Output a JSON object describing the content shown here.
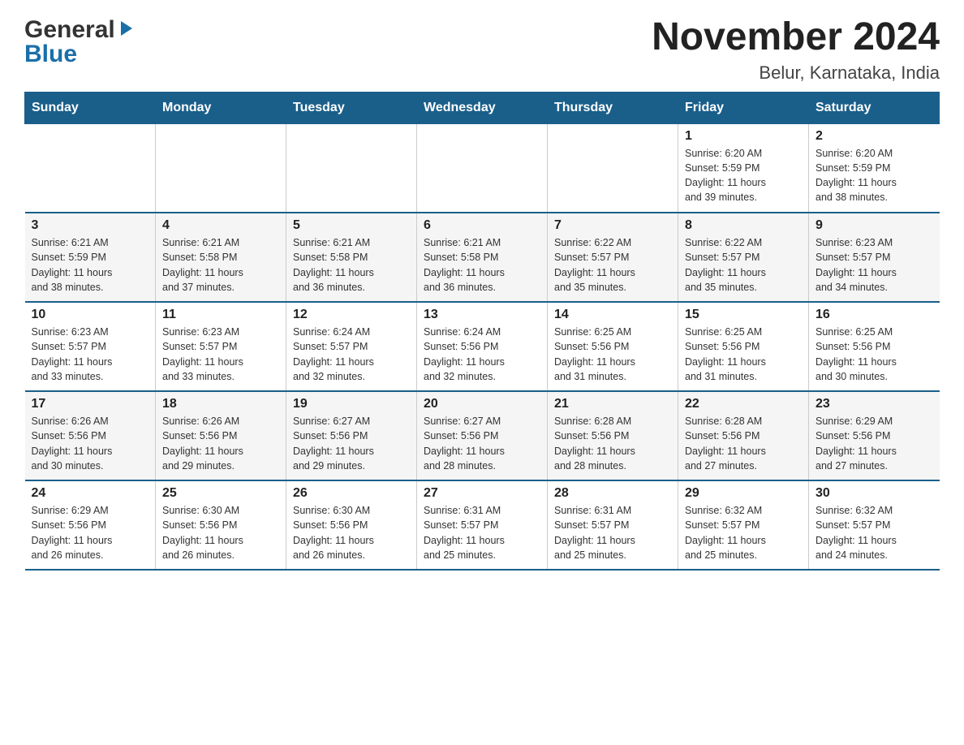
{
  "header": {
    "logo_general": "General",
    "logo_blue": "Blue",
    "month_title": "November 2024",
    "location": "Belur, Karnataka, India"
  },
  "days_of_week": [
    "Sunday",
    "Monday",
    "Tuesday",
    "Wednesday",
    "Thursday",
    "Friday",
    "Saturday"
  ],
  "weeks": [
    [
      {
        "day": "",
        "info": ""
      },
      {
        "day": "",
        "info": ""
      },
      {
        "day": "",
        "info": ""
      },
      {
        "day": "",
        "info": ""
      },
      {
        "day": "",
        "info": ""
      },
      {
        "day": "1",
        "info": "Sunrise: 6:20 AM\nSunset: 5:59 PM\nDaylight: 11 hours\nand 39 minutes."
      },
      {
        "day": "2",
        "info": "Sunrise: 6:20 AM\nSunset: 5:59 PM\nDaylight: 11 hours\nand 38 minutes."
      }
    ],
    [
      {
        "day": "3",
        "info": "Sunrise: 6:21 AM\nSunset: 5:59 PM\nDaylight: 11 hours\nand 38 minutes."
      },
      {
        "day": "4",
        "info": "Sunrise: 6:21 AM\nSunset: 5:58 PM\nDaylight: 11 hours\nand 37 minutes."
      },
      {
        "day": "5",
        "info": "Sunrise: 6:21 AM\nSunset: 5:58 PM\nDaylight: 11 hours\nand 36 minutes."
      },
      {
        "day": "6",
        "info": "Sunrise: 6:21 AM\nSunset: 5:58 PM\nDaylight: 11 hours\nand 36 minutes."
      },
      {
        "day": "7",
        "info": "Sunrise: 6:22 AM\nSunset: 5:57 PM\nDaylight: 11 hours\nand 35 minutes."
      },
      {
        "day": "8",
        "info": "Sunrise: 6:22 AM\nSunset: 5:57 PM\nDaylight: 11 hours\nand 35 minutes."
      },
      {
        "day": "9",
        "info": "Sunrise: 6:23 AM\nSunset: 5:57 PM\nDaylight: 11 hours\nand 34 minutes."
      }
    ],
    [
      {
        "day": "10",
        "info": "Sunrise: 6:23 AM\nSunset: 5:57 PM\nDaylight: 11 hours\nand 33 minutes."
      },
      {
        "day": "11",
        "info": "Sunrise: 6:23 AM\nSunset: 5:57 PM\nDaylight: 11 hours\nand 33 minutes."
      },
      {
        "day": "12",
        "info": "Sunrise: 6:24 AM\nSunset: 5:57 PM\nDaylight: 11 hours\nand 32 minutes."
      },
      {
        "day": "13",
        "info": "Sunrise: 6:24 AM\nSunset: 5:56 PM\nDaylight: 11 hours\nand 32 minutes."
      },
      {
        "day": "14",
        "info": "Sunrise: 6:25 AM\nSunset: 5:56 PM\nDaylight: 11 hours\nand 31 minutes."
      },
      {
        "day": "15",
        "info": "Sunrise: 6:25 AM\nSunset: 5:56 PM\nDaylight: 11 hours\nand 31 minutes."
      },
      {
        "day": "16",
        "info": "Sunrise: 6:25 AM\nSunset: 5:56 PM\nDaylight: 11 hours\nand 30 minutes."
      }
    ],
    [
      {
        "day": "17",
        "info": "Sunrise: 6:26 AM\nSunset: 5:56 PM\nDaylight: 11 hours\nand 30 minutes."
      },
      {
        "day": "18",
        "info": "Sunrise: 6:26 AM\nSunset: 5:56 PM\nDaylight: 11 hours\nand 29 minutes."
      },
      {
        "day": "19",
        "info": "Sunrise: 6:27 AM\nSunset: 5:56 PM\nDaylight: 11 hours\nand 29 minutes."
      },
      {
        "day": "20",
        "info": "Sunrise: 6:27 AM\nSunset: 5:56 PM\nDaylight: 11 hours\nand 28 minutes."
      },
      {
        "day": "21",
        "info": "Sunrise: 6:28 AM\nSunset: 5:56 PM\nDaylight: 11 hours\nand 28 minutes."
      },
      {
        "day": "22",
        "info": "Sunrise: 6:28 AM\nSunset: 5:56 PM\nDaylight: 11 hours\nand 27 minutes."
      },
      {
        "day": "23",
        "info": "Sunrise: 6:29 AM\nSunset: 5:56 PM\nDaylight: 11 hours\nand 27 minutes."
      }
    ],
    [
      {
        "day": "24",
        "info": "Sunrise: 6:29 AM\nSunset: 5:56 PM\nDaylight: 11 hours\nand 26 minutes."
      },
      {
        "day": "25",
        "info": "Sunrise: 6:30 AM\nSunset: 5:56 PM\nDaylight: 11 hours\nand 26 minutes."
      },
      {
        "day": "26",
        "info": "Sunrise: 6:30 AM\nSunset: 5:56 PM\nDaylight: 11 hours\nand 26 minutes."
      },
      {
        "day": "27",
        "info": "Sunrise: 6:31 AM\nSunset: 5:57 PM\nDaylight: 11 hours\nand 25 minutes."
      },
      {
        "day": "28",
        "info": "Sunrise: 6:31 AM\nSunset: 5:57 PM\nDaylight: 11 hours\nand 25 minutes."
      },
      {
        "day": "29",
        "info": "Sunrise: 6:32 AM\nSunset: 5:57 PM\nDaylight: 11 hours\nand 25 minutes."
      },
      {
        "day": "30",
        "info": "Sunrise: 6:32 AM\nSunset: 5:57 PM\nDaylight: 11 hours\nand 24 minutes."
      }
    ]
  ]
}
